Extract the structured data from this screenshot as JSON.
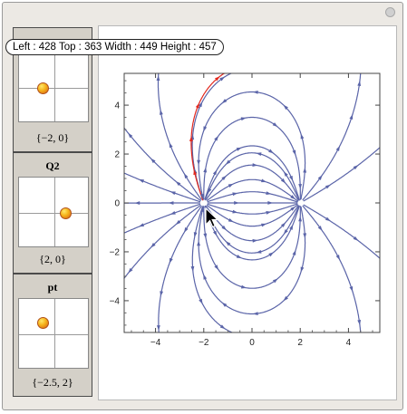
{
  "tooltip": {
    "text": "Left : 428  Top : 363  Width : 449  Height : 457"
  },
  "controls": [
    {
      "label": "",
      "value": "{−2, 0}"
    },
    {
      "label": "Q2",
      "value": "{2, 0}"
    },
    {
      "label": "pt",
      "value": "{−2.5, 2}"
    }
  ],
  "plot": {
    "x_ticks": [
      "−4",
      "−2",
      "0",
      "2",
      "4"
    ],
    "y_ticks": [
      "4",
      "2",
      "0",
      "−2",
      "−4"
    ],
    "xlim": [
      -5.3,
      5.3
    ],
    "ylim": [
      -5.3,
      5.3
    ],
    "charges": [
      [
        -2,
        0
      ],
      [
        2,
        0
      ]
    ],
    "point": [
      -2.5,
      2
    ]
  },
  "colors": {
    "field_line": "#5a64a8",
    "highlight_line": "#e2281e",
    "locator_dot": "#f5b21a"
  }
}
